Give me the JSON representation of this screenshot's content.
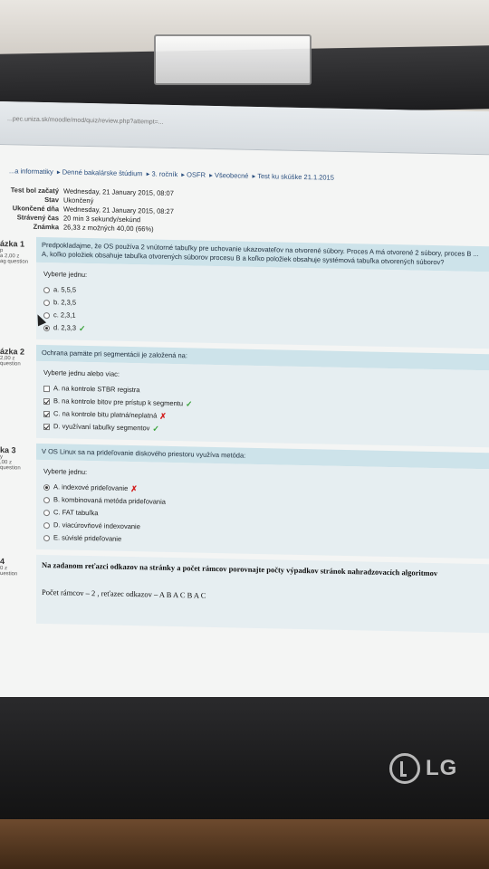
{
  "browser": {
    "url_text": "...pec.uniza.sk/moodle/mod/quiz/review.php?attempt=..."
  },
  "breadcrumb": [
    "...a informatiky",
    "Denné bakalárske štúdium",
    "3. ročník",
    "OSFR",
    "Všeobecné",
    "Test ku skúške 21.1.2015"
  ],
  "summary": [
    {
      "key": "Test bol začatý",
      "value": "Wednesday, 21 January 2015, 08:07"
    },
    {
      "key": "Stav",
      "value": "Ukončený"
    },
    {
      "key": "Ukončené dňa",
      "value": "Wednesday, 21 January 2015, 08:27"
    },
    {
      "key": "Strávený čas",
      "value": "20 min 3 sekundy/sekúnd"
    },
    {
      "key": "Známka",
      "value": "26,33 z možných 40,00 (66%)"
    }
  ],
  "questions": [
    {
      "label": "ázka 1",
      "meta1": "p",
      "meta2": "a 2,00 z",
      "meta3": "ag question",
      "text": "Predpokladajme, že OS používa 2 vnútorné tabuľky pre uchovanie ukazovateľov na otvorené súbory. Proces A má otvorené 2 súbory, proces B ... A, koľko položiek obsahuje tabuľka otvorených súborov procesu B a koľko položiek obsahuje systémová tabuľka otvorených súborov?",
      "prompt": "Vyberte jednu:",
      "options": [
        {
          "label": "a. 5,5,5",
          "selected": false,
          "mark": ""
        },
        {
          "label": "b. 2,3,5",
          "selected": false,
          "mark": ""
        },
        {
          "label": "c. 2,3,1",
          "selected": false,
          "mark": ""
        },
        {
          "label": "d. 2,3,3",
          "selected": true,
          "mark": "✓"
        }
      ]
    },
    {
      "label": "ázka 2",
      "meta1": "",
      "meta2": "2,00 z",
      "meta3": "question",
      "text": "Ochrana pamäte pri segmentácii je založená na:",
      "prompt": "Vyberte jednu alebo viac:",
      "options": [
        {
          "label": "A. na kontrole STBR registra",
          "selected": false,
          "mark": ""
        },
        {
          "label": "B. na kontrole bitov pre prístup k segmentu",
          "selected": true,
          "mark": "✓"
        },
        {
          "label": "C. na kontrole bitu platná/neplatná",
          "selected": true,
          "mark": "✗"
        },
        {
          "label": "D. využívaní tabuľky segmentov",
          "selected": true,
          "mark": "✓"
        }
      ]
    },
    {
      "label": "ka 3",
      "meta1": "y",
      "meta2": ",00 z",
      "meta3": "question",
      "text": "V OS Linux sa na prideľovanie diskového priestoru využíva metóda:",
      "prompt": "Vyberte jednu:",
      "options": [
        {
          "label": "A. indexové prideľovanie",
          "selected": true,
          "mark": "✗"
        },
        {
          "label": "B. kombinovaná metóda prideľovania",
          "selected": false,
          "mark": ""
        },
        {
          "label": "C. FAT tabuľka",
          "selected": false,
          "mark": ""
        },
        {
          "label": "D. viacúrovňové indexovanie",
          "selected": false,
          "mark": ""
        },
        {
          "label": "E. súvislé prideľovanie",
          "selected": false,
          "mark": ""
        }
      ]
    }
  ],
  "question4": {
    "label": "4",
    "meta2": "0 z",
    "meta3": "uestion",
    "title": "Na zadanom reťazci odkazov na stránky a počet rámcov porovnajte počty výpadkov stránok nahradzovacích algoritmov",
    "subtitle": "Počet rámcov – 2 , reťazec odkazov – A B A C B A C"
  },
  "brand": {
    "logo_text": "LG"
  },
  "colors": {
    "question_bg": "#cde3ea",
    "answer_bg": "#e6eef1",
    "correct": "#3aa33a",
    "incorrect": "#d32020"
  }
}
